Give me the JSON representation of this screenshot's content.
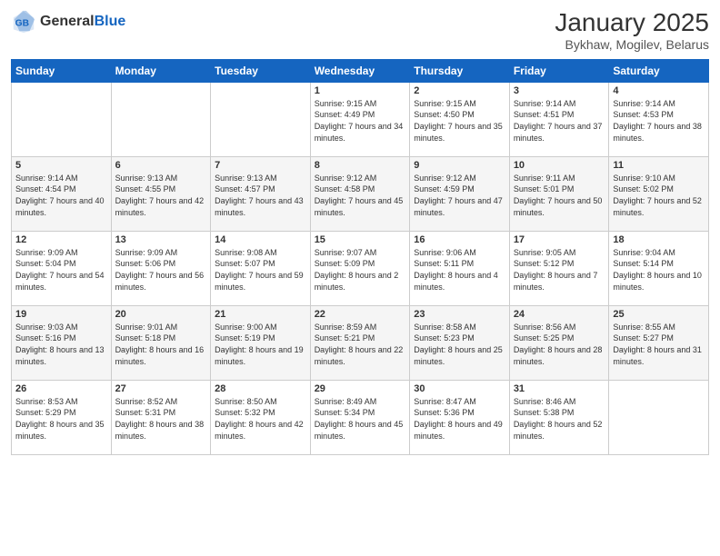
{
  "header": {
    "logo": {
      "general": "General",
      "blue": "Blue"
    },
    "title": "January 2025",
    "location": "Bykhaw, Mogilev, Belarus"
  },
  "weekdays": [
    "Sunday",
    "Monday",
    "Tuesday",
    "Wednesday",
    "Thursday",
    "Friday",
    "Saturday"
  ],
  "weeks": [
    [
      {
        "day": "",
        "sunrise": "",
        "sunset": "",
        "daylight": ""
      },
      {
        "day": "",
        "sunrise": "",
        "sunset": "",
        "daylight": ""
      },
      {
        "day": "",
        "sunrise": "",
        "sunset": "",
        "daylight": ""
      },
      {
        "day": "1",
        "sunrise": "Sunrise: 9:15 AM",
        "sunset": "Sunset: 4:49 PM",
        "daylight": "Daylight: 7 hours and 34 minutes."
      },
      {
        "day": "2",
        "sunrise": "Sunrise: 9:15 AM",
        "sunset": "Sunset: 4:50 PM",
        "daylight": "Daylight: 7 hours and 35 minutes."
      },
      {
        "day": "3",
        "sunrise": "Sunrise: 9:14 AM",
        "sunset": "Sunset: 4:51 PM",
        "daylight": "Daylight: 7 hours and 37 minutes."
      },
      {
        "day": "4",
        "sunrise": "Sunrise: 9:14 AM",
        "sunset": "Sunset: 4:53 PM",
        "daylight": "Daylight: 7 hours and 38 minutes."
      }
    ],
    [
      {
        "day": "5",
        "sunrise": "Sunrise: 9:14 AM",
        "sunset": "Sunset: 4:54 PM",
        "daylight": "Daylight: 7 hours and 40 minutes."
      },
      {
        "day": "6",
        "sunrise": "Sunrise: 9:13 AM",
        "sunset": "Sunset: 4:55 PM",
        "daylight": "Daylight: 7 hours and 42 minutes."
      },
      {
        "day": "7",
        "sunrise": "Sunrise: 9:13 AM",
        "sunset": "Sunset: 4:57 PM",
        "daylight": "Daylight: 7 hours and 43 minutes."
      },
      {
        "day": "8",
        "sunrise": "Sunrise: 9:12 AM",
        "sunset": "Sunset: 4:58 PM",
        "daylight": "Daylight: 7 hours and 45 minutes."
      },
      {
        "day": "9",
        "sunrise": "Sunrise: 9:12 AM",
        "sunset": "Sunset: 4:59 PM",
        "daylight": "Daylight: 7 hours and 47 minutes."
      },
      {
        "day": "10",
        "sunrise": "Sunrise: 9:11 AM",
        "sunset": "Sunset: 5:01 PM",
        "daylight": "Daylight: 7 hours and 50 minutes."
      },
      {
        "day": "11",
        "sunrise": "Sunrise: 9:10 AM",
        "sunset": "Sunset: 5:02 PM",
        "daylight": "Daylight: 7 hours and 52 minutes."
      }
    ],
    [
      {
        "day": "12",
        "sunrise": "Sunrise: 9:09 AM",
        "sunset": "Sunset: 5:04 PM",
        "daylight": "Daylight: 7 hours and 54 minutes."
      },
      {
        "day": "13",
        "sunrise": "Sunrise: 9:09 AM",
        "sunset": "Sunset: 5:06 PM",
        "daylight": "Daylight: 7 hours and 56 minutes."
      },
      {
        "day": "14",
        "sunrise": "Sunrise: 9:08 AM",
        "sunset": "Sunset: 5:07 PM",
        "daylight": "Daylight: 7 hours and 59 minutes."
      },
      {
        "day": "15",
        "sunrise": "Sunrise: 9:07 AM",
        "sunset": "Sunset: 5:09 PM",
        "daylight": "Daylight: 8 hours and 2 minutes."
      },
      {
        "day": "16",
        "sunrise": "Sunrise: 9:06 AM",
        "sunset": "Sunset: 5:11 PM",
        "daylight": "Daylight: 8 hours and 4 minutes."
      },
      {
        "day": "17",
        "sunrise": "Sunrise: 9:05 AM",
        "sunset": "Sunset: 5:12 PM",
        "daylight": "Daylight: 8 hours and 7 minutes."
      },
      {
        "day": "18",
        "sunrise": "Sunrise: 9:04 AM",
        "sunset": "Sunset: 5:14 PM",
        "daylight": "Daylight: 8 hours and 10 minutes."
      }
    ],
    [
      {
        "day": "19",
        "sunrise": "Sunrise: 9:03 AM",
        "sunset": "Sunset: 5:16 PM",
        "daylight": "Daylight: 8 hours and 13 minutes."
      },
      {
        "day": "20",
        "sunrise": "Sunrise: 9:01 AM",
        "sunset": "Sunset: 5:18 PM",
        "daylight": "Daylight: 8 hours and 16 minutes."
      },
      {
        "day": "21",
        "sunrise": "Sunrise: 9:00 AM",
        "sunset": "Sunset: 5:19 PM",
        "daylight": "Daylight: 8 hours and 19 minutes."
      },
      {
        "day": "22",
        "sunrise": "Sunrise: 8:59 AM",
        "sunset": "Sunset: 5:21 PM",
        "daylight": "Daylight: 8 hours and 22 minutes."
      },
      {
        "day": "23",
        "sunrise": "Sunrise: 8:58 AM",
        "sunset": "Sunset: 5:23 PM",
        "daylight": "Daylight: 8 hours and 25 minutes."
      },
      {
        "day": "24",
        "sunrise": "Sunrise: 8:56 AM",
        "sunset": "Sunset: 5:25 PM",
        "daylight": "Daylight: 8 hours and 28 minutes."
      },
      {
        "day": "25",
        "sunrise": "Sunrise: 8:55 AM",
        "sunset": "Sunset: 5:27 PM",
        "daylight": "Daylight: 8 hours and 31 minutes."
      }
    ],
    [
      {
        "day": "26",
        "sunrise": "Sunrise: 8:53 AM",
        "sunset": "Sunset: 5:29 PM",
        "daylight": "Daylight: 8 hours and 35 minutes."
      },
      {
        "day": "27",
        "sunrise": "Sunrise: 8:52 AM",
        "sunset": "Sunset: 5:31 PM",
        "daylight": "Daylight: 8 hours and 38 minutes."
      },
      {
        "day": "28",
        "sunrise": "Sunrise: 8:50 AM",
        "sunset": "Sunset: 5:32 PM",
        "daylight": "Daylight: 8 hours and 42 minutes."
      },
      {
        "day": "29",
        "sunrise": "Sunrise: 8:49 AM",
        "sunset": "Sunset: 5:34 PM",
        "daylight": "Daylight: 8 hours and 45 minutes."
      },
      {
        "day": "30",
        "sunrise": "Sunrise: 8:47 AM",
        "sunset": "Sunset: 5:36 PM",
        "daylight": "Daylight: 8 hours and 49 minutes."
      },
      {
        "day": "31",
        "sunrise": "Sunrise: 8:46 AM",
        "sunset": "Sunset: 5:38 PM",
        "daylight": "Daylight: 8 hours and 52 minutes."
      },
      {
        "day": "",
        "sunrise": "",
        "sunset": "",
        "daylight": ""
      }
    ]
  ]
}
